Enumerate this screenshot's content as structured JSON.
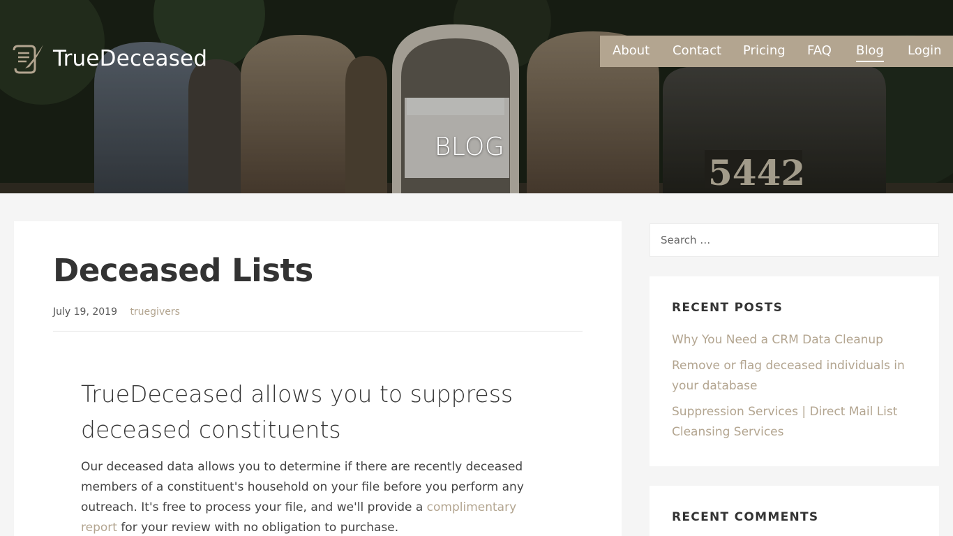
{
  "brand": {
    "name": "TrueDeceased",
    "accent": "#b3a590"
  },
  "nav": {
    "items": [
      {
        "label": "About"
      },
      {
        "label": "Contact"
      },
      {
        "label": "Pricing"
      },
      {
        "label": "FAQ"
      },
      {
        "label": "Blog",
        "active": true
      },
      {
        "label": "Login"
      }
    ]
  },
  "hero": {
    "title": "BLOG"
  },
  "post": {
    "title": "Deceased Lists",
    "date": "July 19, 2019",
    "author": "truegivers",
    "heading": "TrueDeceased allows you to suppress deceased constituents",
    "body_before_link": "Our deceased data allows you to determine if there are recently deceased members of a constituent's household on your file before you perform any outreach. It's free to process your file, and we'll provide a ",
    "body_link": "complimentary report",
    "body_after_link": " for your review with no obligation to purchase."
  },
  "sidebar": {
    "search": {
      "placeholder": "Search …"
    },
    "recent_posts": {
      "title": "RECENT POSTS",
      "items": [
        "Why You Need a CRM Data Cleanup",
        "Remove or flag deceased individuals in your database",
        "Suppression Services | Direct Mail List Cleansing Services"
      ]
    },
    "recent_comments": {
      "title": "RECENT COMMENTS"
    }
  }
}
